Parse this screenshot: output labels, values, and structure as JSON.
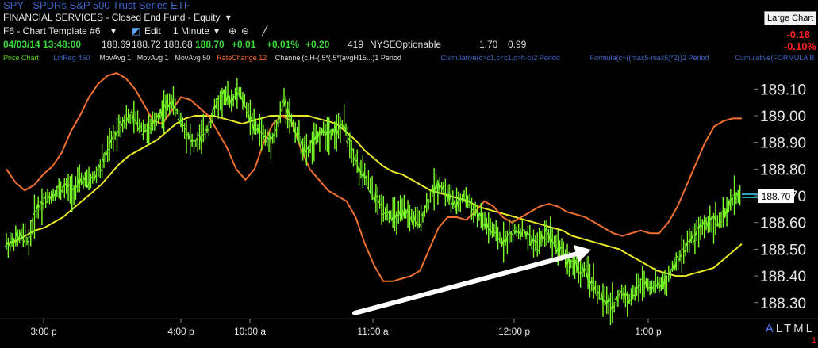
{
  "header": {
    "symbol_line": "SPY - SPDRs S&P 500 Trust Series ETF",
    "category_line": "FINANCIAL SERVICES - Closed End Fund - Equity",
    "template_dropdown": "F6 - Chart Template #6",
    "edit_label": "Edit",
    "interval_dropdown": "1 Minute",
    "large_chart_button": "Large Chart",
    "change_abs": "-0.18",
    "change_pct": "-0.10%"
  },
  "quote": {
    "datetime": "04/03/14 13:48:00",
    "open": "188.69",
    "high": "188.72",
    "low": "188.68",
    "last": "188.70",
    "change": "+0.01",
    "change_pct": "+0.01%",
    "net": "+0.20",
    "volume": "419",
    "exchange": "NYSE",
    "optionable": "Optionable",
    "v1": "1.70",
    "v2": "0.99"
  },
  "indicators": [
    {
      "label": "Price Chart",
      "color": "#59d626"
    },
    {
      "label": "LinReg 450",
      "color": "#3a66c8"
    },
    {
      "label": "MovAvg 1",
      "color": "#dddddd"
    },
    {
      "label": "MovAvg 1",
      "color": "#dddddd"
    },
    {
      "label": "MovAvg 50",
      "color": "#dddddd"
    },
    {
      "label": "RateChange 12",
      "color": "#ff6a2a"
    },
    {
      "label": "Channel(c,H-(.5*(.5*(avgH15...)1 Period",
      "color": "#dddddd"
    },
    {
      "label": "Cumulative(c>c1,c<c1,c>h-c)2 Period",
      "color": "#3a66c8"
    },
    {
      "label": "Formula(c+((max5-max5)*2))2 Period",
      "color": "#3a66c8"
    },
    {
      "label": "Cumulative(FORMULA B",
      "color": "#3a66c8"
    }
  ],
  "colors": {
    "price": "#7dff2a",
    "ma": "#e8e829",
    "rate_change": "#f07030",
    "arrow": "#ffffff",
    "last_label_bg": "#ffffff"
  },
  "chart_data": {
    "type": "line",
    "ylim": [
      188.24,
      189.19
    ],
    "y_ticks": [
      "189.10",
      "189.00",
      "188.90",
      "188.80",
      "188.70",
      "188.60",
      "188.50",
      "188.40",
      "188.30"
    ],
    "x_ticks": [
      "3:00 p",
      "4:00 p",
      "10:00 a",
      "11:00 a",
      "12:00 p",
      "1:00 p"
    ],
    "last_value_label": "188.70",
    "series": [
      {
        "key": "price",
        "values": [
          188.52,
          188.53,
          188.55,
          188.53,
          188.65,
          188.68,
          188.7,
          188.72,
          188.73,
          188.72,
          188.76,
          188.75,
          188.78,
          188.83,
          188.9,
          188.96,
          188.99,
          188.99,
          188.96,
          188.94,
          188.99,
          189.02,
          189.06,
          189.0,
          188.94,
          188.89,
          188.92,
          188.96,
          189.04,
          189.07,
          189.06,
          189.09,
          189.03,
          188.96,
          188.94,
          188.9,
          188.95,
          189.06,
          188.98,
          188.92,
          188.86,
          188.9,
          188.94,
          188.94,
          188.94,
          188.97,
          188.88,
          188.8,
          188.76,
          188.7,
          188.66,
          188.63,
          188.62,
          188.64,
          188.62,
          188.6,
          188.66,
          188.73,
          188.74,
          188.7,
          188.66,
          188.7,
          188.66,
          188.62,
          188.59,
          188.56,
          188.53,
          188.55,
          188.57,
          188.56,
          188.53,
          188.52,
          188.57,
          188.53,
          188.5,
          188.45,
          188.44,
          188.42,
          188.38,
          188.33,
          188.3,
          188.29,
          188.34,
          188.31,
          188.35,
          188.38,
          188.36,
          188.37,
          188.38,
          188.44,
          188.48,
          188.53,
          188.56,
          188.59,
          188.61,
          188.6,
          188.64,
          188.7,
          188.7
        ]
      },
      {
        "key": "ma",
        "values": [
          188.52,
          188.53,
          188.55,
          188.57,
          188.58,
          188.6,
          188.62,
          188.65,
          188.68,
          188.71,
          188.74,
          188.78,
          188.82,
          188.85,
          188.87,
          188.89,
          188.91,
          188.94,
          188.97,
          188.99,
          189.0,
          189.0,
          189.0,
          188.99,
          188.98,
          188.97,
          188.98,
          188.99,
          189.0,
          189.0,
          189.0,
          189.0,
          189.0,
          188.99,
          188.98,
          188.97,
          188.94,
          188.91,
          188.87,
          188.84,
          188.81,
          188.79,
          188.78,
          188.76,
          188.74,
          188.72,
          188.71,
          188.7,
          188.69,
          188.68,
          188.66,
          188.65,
          188.64,
          188.63,
          188.62,
          188.61,
          188.6,
          188.59,
          188.58,
          188.57,
          188.55,
          188.54,
          188.53,
          188.52,
          188.51,
          188.5,
          188.48,
          188.46,
          188.44,
          188.42,
          188.41,
          188.4,
          188.4,
          188.41,
          188.42,
          188.43,
          188.46,
          188.49,
          188.52
        ]
      },
      {
        "key": "rate_change",
        "values": [
          188.8,
          188.75,
          188.72,
          188.74,
          188.78,
          188.81,
          188.86,
          188.94,
          189.0,
          189.07,
          189.12,
          189.15,
          189.16,
          189.14,
          189.1,
          189.04,
          188.98,
          188.97,
          189.02,
          189.07,
          189.06,
          189.03,
          189.0,
          188.94,
          188.88,
          188.8,
          188.76,
          188.8,
          188.9,
          188.97,
          189.0,
          188.98,
          188.88,
          188.8,
          188.76,
          188.72,
          188.7,
          188.68,
          188.62,
          188.52,
          188.44,
          188.38,
          188.38,
          188.39,
          188.4,
          188.42,
          188.5,
          188.58,
          188.62,
          188.62,
          188.61,
          188.64,
          188.68,
          188.66,
          188.62,
          188.6,
          188.62,
          188.64,
          188.66,
          188.67,
          188.66,
          188.64,
          188.63,
          188.62,
          188.6,
          188.58,
          188.56,
          188.55,
          188.56,
          188.57,
          188.56,
          188.56,
          188.6,
          188.66,
          188.74,
          188.82,
          188.9,
          188.96,
          188.98,
          188.99,
          188.99
        ]
      }
    ]
  }
}
